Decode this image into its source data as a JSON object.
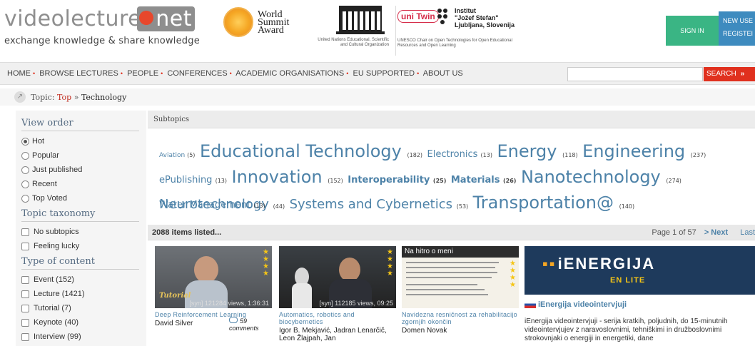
{
  "header": {
    "logo_main": "videolectures",
    "logo_net": "net",
    "tagline": "exchange knowledge & share knowledge",
    "wsa_line1": "World",
    "wsa_line2": "Summit",
    "wsa_line3": "Award",
    "unesco_caption": "United Nations Educational, Scientific and Cultural Organization",
    "unitwin_logo": "uni Twin",
    "ijs_line1": "Institut",
    "ijs_line2": "\"Jožef Stefan\"",
    "ijs_line3": "Ljubljana, Slovenija",
    "unitwin_caption": "UNESCO Chair on Open Technologies for Open Educational Resources and Open Learning",
    "signin": "SIGN IN",
    "new_user": "NEW USE",
    "register": "REGISTEI"
  },
  "nav": {
    "items": [
      "HOME",
      "BROWSE LECTURES",
      "PEOPLE",
      "CONFERENCES",
      "ACADEMIC ORGANISATIONS",
      "EU SUPPORTED",
      "ABOUT US"
    ],
    "search_value": "",
    "search_label": "SEARCH",
    "search_chev": "»"
  },
  "breadcrumb": {
    "prefix": "Topic:",
    "top": "Top",
    "sep": "»",
    "current": "Technology"
  },
  "sidebar": {
    "view_order_title": "View order",
    "view_order": [
      "Hot",
      "Popular",
      "Just published",
      "Recent",
      "Top Voted"
    ],
    "taxonomy_title": "Topic taxonomy",
    "taxonomy": [
      "No subtopics",
      "Feeling lucky"
    ],
    "type_title": "Type of content",
    "types": [
      "Event (152)",
      "Lecture (1421)",
      "Tutorial (7)",
      "Keynote (40)",
      "Interview (99)"
    ]
  },
  "subtopics": {
    "title": "Subtopics",
    "tags": [
      {
        "name": "Aviation",
        "count": "(5)",
        "size": "s"
      },
      {
        "name": "Educational Technology",
        "count": "(182)",
        "size": "l"
      },
      {
        "name": "Electronics",
        "count": "(13)",
        "size": "m"
      },
      {
        "name": "Energy",
        "count": "(118)",
        "size": "l"
      },
      {
        "name": "Engineering",
        "count": "(237)",
        "size": "l"
      },
      {
        "name": "ePublishing",
        "count": "(13)",
        "size": "m"
      },
      {
        "name": "Innovation",
        "count": "(152)",
        "size": "l"
      },
      {
        "name": "Interoperability",
        "count": "(25)",
        "size": "mb"
      },
      {
        "name": "Materials",
        "count": "(26)",
        "size": "mb"
      },
      {
        "name": "Nanotechnology",
        "count": "(274)",
        "size": "l"
      },
      {
        "name": "Neurotechnology",
        "count": "(44)",
        "size": "xl"
      },
      {
        "name": "Systems and Cybernetics",
        "count": "(53)",
        "size": "xl"
      },
      {
        "name": "Transportation@",
        "count": "(140)",
        "size": "l"
      },
      {
        "name": "Water Management",
        "count": "(13)",
        "size": "m"
      }
    ]
  },
  "listing": {
    "count": "2088 items listed...",
    "page": "Page 1 of 57",
    "next": "> Next",
    "last": "Last"
  },
  "cards": [
    {
      "title": "Deep Reinforcement Learning",
      "author": "David Silver",
      "meta": "[syn]  121284 views, 1:36:31",
      "badge": "Tutorial",
      "comments": "59 comments",
      "stars": 4
    },
    {
      "title": "Automatics, robotics and biocybernetics",
      "author": "Igor B. Mekjavić, Jadran Lenarčič, Leon Žlajpah, Jan",
      "meta": "[syn]  112185 views, 09:25",
      "badge": "",
      "comments": "",
      "stars": 4
    },
    {
      "title": "Navidezna resničnost za rehabilitacijo zgornjih okončin",
      "author": "Domen Novak",
      "meta": "",
      "slide_title": "Na hitro o meni",
      "badge": "",
      "comments": "",
      "stars": 4
    }
  ],
  "feature": {
    "brand": "iENERGIJA",
    "brand_sub": "EN LITE",
    "title": "iEnergija videointervjuji",
    "desc": "iEnergija videointervjuji - serija kratkih, poljudnih, do 15-minutnih videointervjujev z naravoslovnimi, tehniškimi in družboslovnimi strokovnjaki o energiji in energetiki, dane"
  },
  "colors": {
    "accent_red": "#e0301e",
    "link_blue": "#4d82a8",
    "signin_green": "#3ab584",
    "register_blue": "#3e8bbf"
  }
}
